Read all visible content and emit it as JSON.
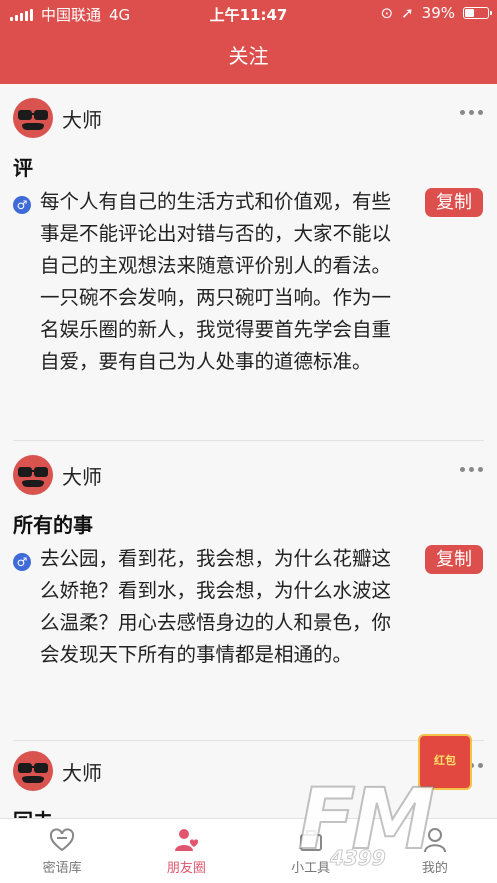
{
  "status_bar": {
    "carrier": "中国联通",
    "network": "4G",
    "time": "上午11:47",
    "battery_percent": "39%"
  },
  "header": {
    "title": "关注"
  },
  "posts": [
    {
      "author": "大师",
      "title": "评",
      "gender_symbol": "♂",
      "body": "每个人有自己的生活方式和价值观，有些事是不能评论出对错与否的，大家不能以自己的主观想法来随意评价别人的看法。一只碗不会发响，两只碗叮当响。作为一名娱乐圈的新人，我觉得要首先学会自重自爱，要有自己为人处事的道德标准。",
      "copy_label": "复制"
    },
    {
      "author": "大师",
      "title": "所有的事",
      "gender_symbol": "♂",
      "body": "去公园，看到花，我会想，为什么花瓣这么娇艳？看到水，我会想，为什么水波这么温柔？用心去感悟身边的人和景色，你会发现天下所有的事情都是相通的。",
      "copy_label": "复制"
    },
    {
      "author": "大师",
      "title": "回去"
    }
  ],
  "float_badge": {
    "text": "红包"
  },
  "tabbar": {
    "tabs": [
      {
        "label": "密语库",
        "icon": "heart-chat-icon",
        "active": false
      },
      {
        "label": "朋友圈",
        "icon": "person-heart-icon",
        "active": true
      },
      {
        "label": "小工具",
        "icon": "toolbox-icon",
        "active": false
      },
      {
        "label": "我的",
        "icon": "user-icon",
        "active": false
      }
    ]
  },
  "watermark": {
    "text": "FM",
    "subtext": "4399"
  }
}
